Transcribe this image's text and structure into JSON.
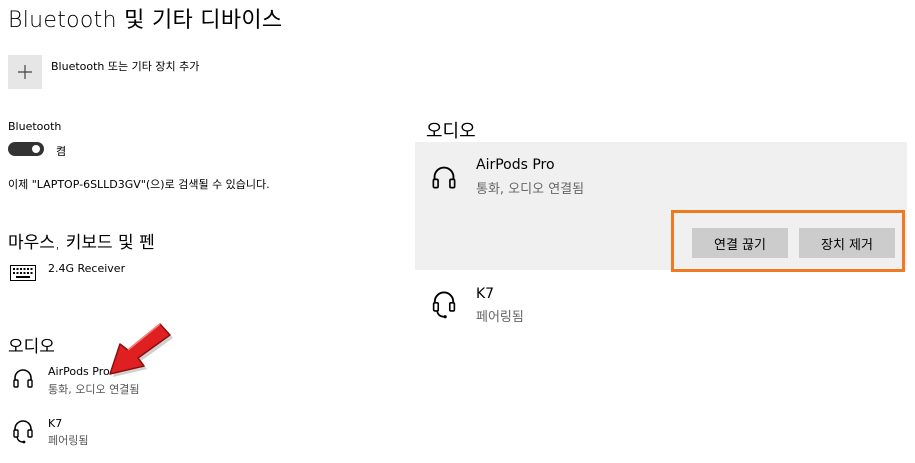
{
  "page": {
    "title": "Bluetooth 및 기타 디바이스"
  },
  "add_device": {
    "label": "Bluetooth 또는 기타 장치 추가"
  },
  "bluetooth": {
    "label": "Bluetooth",
    "toggle_state": "켬",
    "discoverable_text": "이제 \"LAPTOP-6SLLD3GV\"(으)로 검색될 수 있습니다."
  },
  "mouse_section": {
    "title": "마우스, 키보드 및 펜",
    "items": [
      {
        "name": "2.4G Receiver",
        "icon": "keyboard-icon"
      }
    ]
  },
  "audio_section_left": {
    "title": "오디오",
    "items": [
      {
        "name": "AirPods Pro",
        "status": "통화, 오디오 연결됨",
        "icon": "headphones-icon"
      },
      {
        "name": "K7",
        "status": "페어링됨",
        "icon": "headset-icon"
      }
    ]
  },
  "audio_section_right": {
    "title": "오디오",
    "selected": {
      "name": "AirPods Pro",
      "status": "통화, 오디오 연결됨",
      "icon": "headphones-icon"
    },
    "buttons": {
      "disconnect": "연결 끊기",
      "remove": "장치 제거"
    },
    "items": [
      {
        "name": "K7",
        "status": "페어링됨",
        "icon": "headset-icon"
      }
    ]
  },
  "colors": {
    "highlight": "#f07a1f",
    "arrow": "#e02020",
    "panel_bg": "#f0f0f0",
    "button_bg": "#cccccc"
  }
}
